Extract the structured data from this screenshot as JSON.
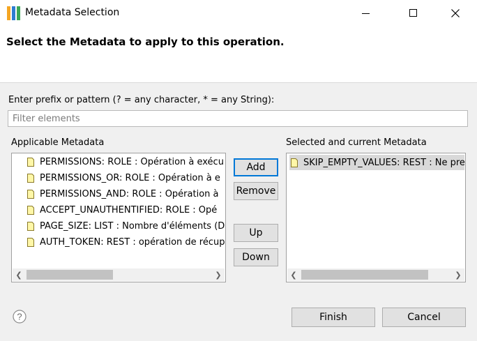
{
  "window": {
    "title": "Metadata Selection",
    "icon_colors": [
      "#f5a623",
      "#2e7dd1",
      "#3aa757"
    ],
    "controls": [
      "minimize-icon",
      "maximize-icon",
      "close-icon"
    ]
  },
  "header": {
    "title": "Select the Metadata to apply to this operation."
  },
  "filter": {
    "label": "Enter prefix or pattern (? = any character, * = any String):",
    "placeholder": "Filter elements",
    "value": ""
  },
  "applicable": {
    "label": "Applicable Metadata",
    "items": [
      "PERMISSIONS: ROLE : Opération à exécu",
      "PERMISSIONS_OR: ROLE : Opération à e",
      "PERMISSIONS_AND: ROLE : Opération à",
      "ACCEPT_UNAUTHENTIFIED: ROLE : Opé",
      "PAGE_SIZE: LIST : Nombre d'éléments (D",
      "AUTH_TOKEN: REST : opération de récup"
    ]
  },
  "selected": {
    "label": "Selected and current Metadata",
    "items": [
      "SKIP_EMPTY_VALUES: REST : Ne pre"
    ]
  },
  "buttons": {
    "add": "Add",
    "remove": "Remove",
    "up": "Up",
    "down": "Down",
    "finish": "Finish",
    "cancel": "Cancel"
  },
  "colors": {
    "accent": "#0078d7",
    "doc_icon_fill": "#fff7a8",
    "doc_icon_stroke": "#8a7a2a"
  }
}
